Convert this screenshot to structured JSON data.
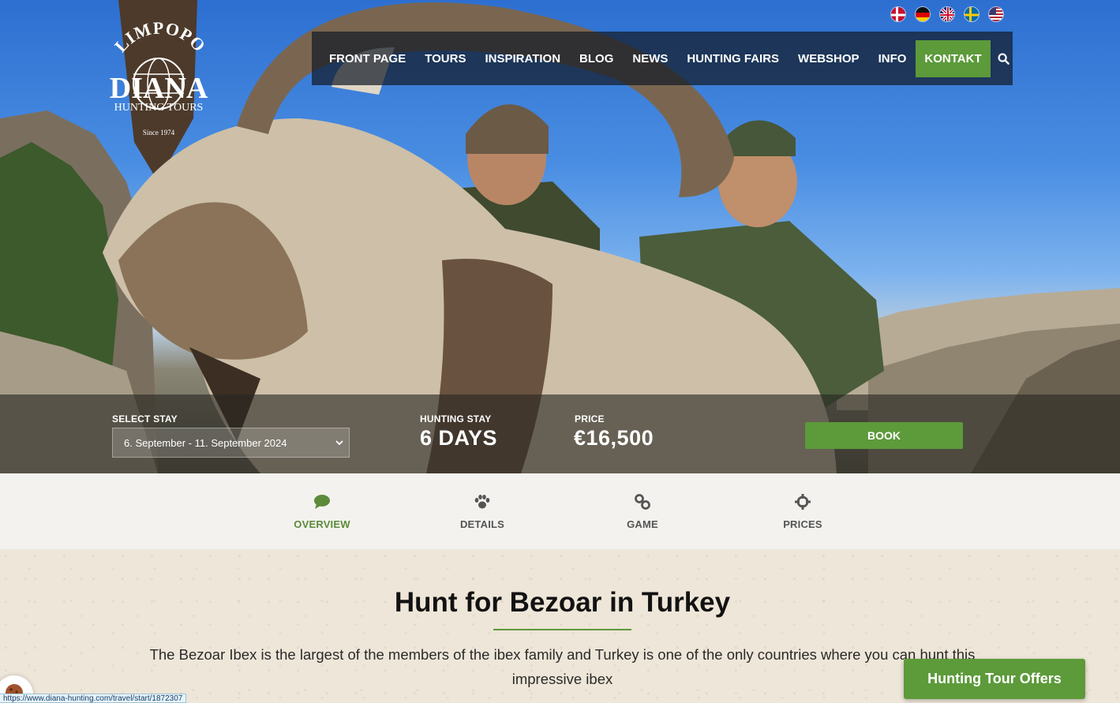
{
  "flags": [
    {
      "name": "danish-flag-icon"
    },
    {
      "name": "german-flag-icon"
    },
    {
      "name": "uk-flag-icon"
    },
    {
      "name": "swedish-flag-icon"
    },
    {
      "name": "us-flag-icon"
    }
  ],
  "logo": {
    "top_text": "LIMPOPO",
    "main_text": "DIANA",
    "sub_text": "HUNTING TOURS",
    "since": "Since 1974"
  },
  "nav": {
    "items": [
      "FRONT PAGE",
      "TOURS",
      "INSPIRATION",
      "BLOG",
      "NEWS",
      "HUNTING FAIRS",
      "WEBSHOP",
      "INFO"
    ],
    "active": "KONTAKT",
    "search_icon": "search-icon"
  },
  "booking": {
    "select_label": "SELECT STAY",
    "select_value": "6. September - 11. September 2024",
    "stay_label": "HUNTING STAY",
    "stay_value": "6 DAYS",
    "price_label": "PRICE",
    "price_value": "€16,500",
    "book_label": "BOOK"
  },
  "tabs": [
    {
      "label": "OVERVIEW",
      "icon": "speech-bubble-icon"
    },
    {
      "label": "DETAILS",
      "icon": "paw-icon"
    },
    {
      "label": "GAME",
      "icon": "link-icon"
    },
    {
      "label": "PRICES",
      "icon": "crosshair-icon"
    }
  ],
  "content": {
    "title": "Hunt for Bezoar in Turkey",
    "intro": "The Bezoar Ibex is the largest of the members of the ibex family and Turkey is one of the only countries where you can hunt this impressive ibex"
  },
  "offers_button": "Hunting Tour Offers",
  "status_url": "https://www.diana-hunting.com/travel/start/1872307",
  "colors": {
    "accent_green": "#5c9a3a",
    "nav_bg": "#141c28"
  }
}
